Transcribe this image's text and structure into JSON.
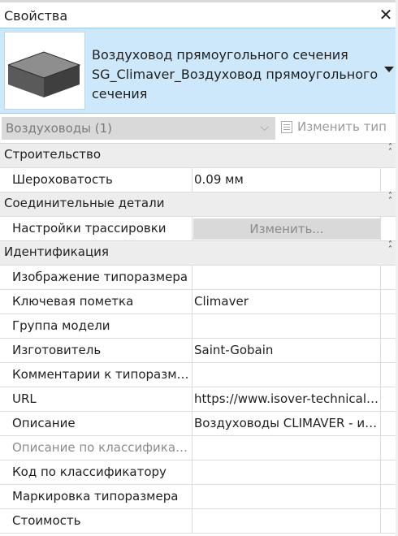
{
  "panel": {
    "title": "Свойства",
    "close_glyph": "✕"
  },
  "type_selector": {
    "line1": "Воздуховод прямоугольного сечения",
    "line2": "SG_Climaver_Воздуховод прямоугольного",
    "line3": "сечения",
    "thumbnail_icon": "rectangular-duct-3d-icon"
  },
  "filter": {
    "value": "Воздуховоды (1)",
    "edit_type_label": "Изменить тип"
  },
  "groups": {
    "construction": {
      "label": "Строительство"
    },
    "connectors": {
      "label": "Соединительные детали"
    },
    "identity": {
      "label": "Идентификация"
    }
  },
  "props": {
    "roughness": {
      "name": "Шероховатость",
      "value": "0.09 мм"
    },
    "routing": {
      "name": "Настройки трассировки",
      "button": "Изменить..."
    },
    "type_image": {
      "name": "Изображение типоразмера",
      "value": ""
    },
    "keynote": {
      "name": "Ключевая пометка",
      "value": "Climaver"
    },
    "model_group": {
      "name": "Группа модели",
      "value": ""
    },
    "manufacturer": {
      "name": "Изготовитель",
      "value": "Saint-Gobain"
    },
    "type_comments": {
      "name": "Комментарии к типоразмеру",
      "value": ""
    },
    "url": {
      "name": "URL",
      "value": "https://www.isover-technical-insulation.ru"
    },
    "description": {
      "name": "Описание",
      "value": "Воздуховоды CLIMAVER - изоляционные воздуховоды"
    },
    "classification_desc": {
      "name": "Описание по классификатору",
      "value": ""
    },
    "classification_code": {
      "name": "Код по классификатору",
      "value": ""
    },
    "type_mark": {
      "name": "Маркировка типоразмера",
      "value": ""
    },
    "cost": {
      "name": "Стоимость",
      "value": ""
    }
  },
  "colors": {
    "selector_bg": "#cce8fa",
    "group_bg": "#ededed",
    "disabled": "#8c8c8c"
  }
}
